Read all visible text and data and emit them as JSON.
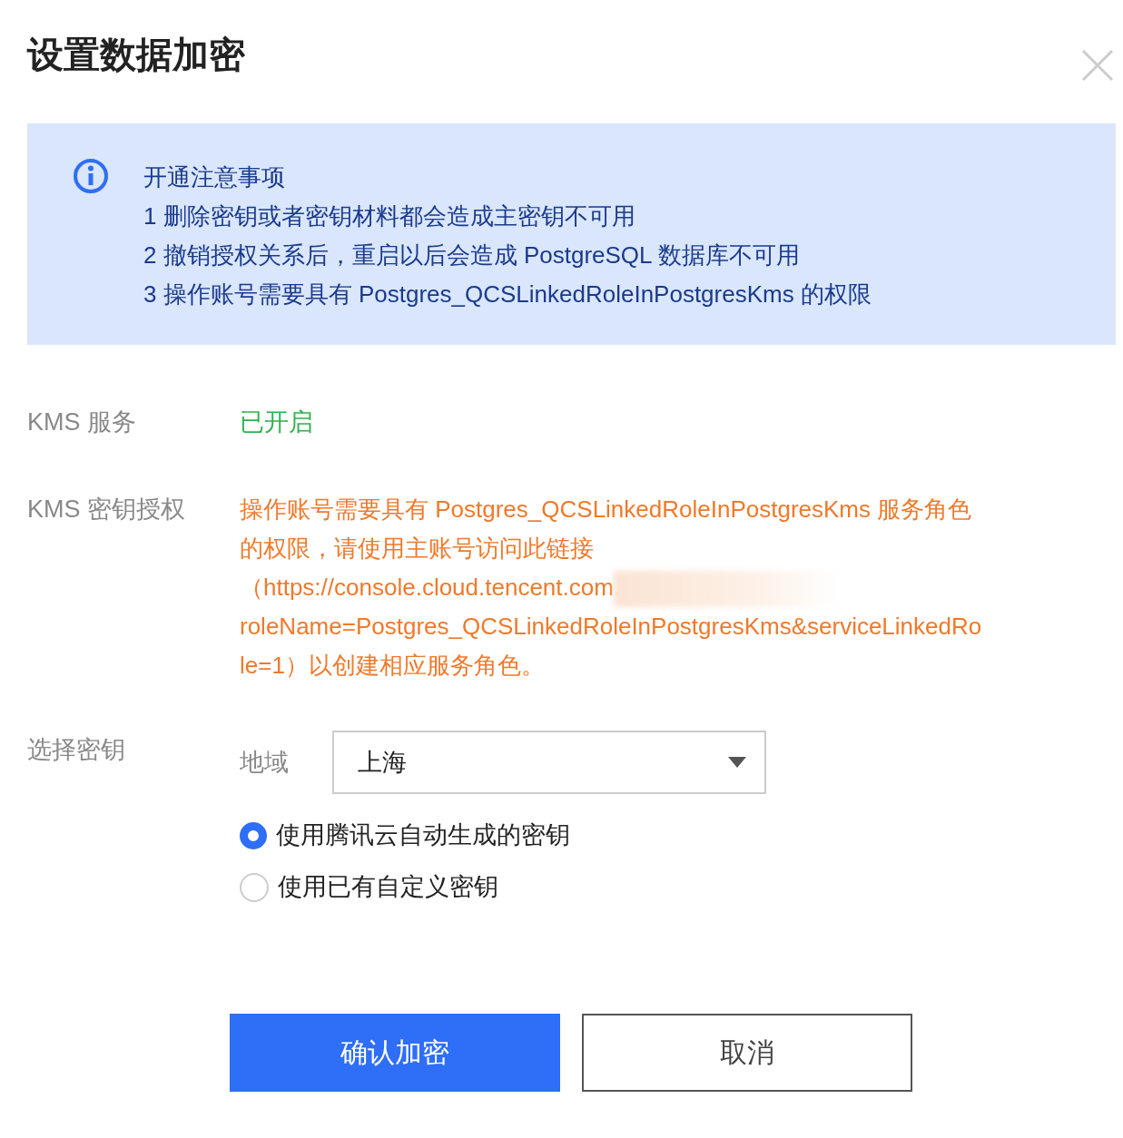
{
  "dialog": {
    "title": "设置数据加密"
  },
  "notice": {
    "heading": "开通注意事项",
    "items": [
      "1 删除密钥或者密钥材料都会造成主密钥不可用",
      "2 撤销授权关系后，重启以后会造成 PostgreSQL 数据库不可用",
      "3 操作账号需要具有 Postgres_QCSLinkedRoleInPostgresKms 的权限"
    ]
  },
  "kms_service": {
    "label": "KMS 服务",
    "value": "已开启"
  },
  "kms_key_auth": {
    "label": "KMS 密钥授权",
    "lines": [
      {
        "text": "操作账号需要具有 Postgres_QCSLinkedRoleInPostgresKms 服务角色",
        "blurred_after": false
      },
      {
        "text": "的权限，请使用主账号访问此链接",
        "blurred_after": false
      },
      {
        "text": "（https://console.cloud.tencent.com",
        "blurred_after": true
      },
      {
        "text": "roleName=Postgres_QCSLinkedRoleInPostgresKms&serviceLinkedRo",
        "blurred_after": false
      },
      {
        "text": "le=1）以创建相应服务角色。",
        "blurred_after": false
      }
    ]
  },
  "select_key": {
    "label": "选择密钥",
    "region": {
      "label": "地域",
      "value": "上海"
    },
    "options": [
      {
        "label": "使用腾讯云自动生成的密钥",
        "selected": true
      },
      {
        "label": "使用已有自定义密钥",
        "selected": false
      }
    ]
  },
  "buttons": [
    {
      "label": "确认加密",
      "kind": "primary"
    },
    {
      "label": "取消",
      "kind": "secondary"
    }
  ]
}
